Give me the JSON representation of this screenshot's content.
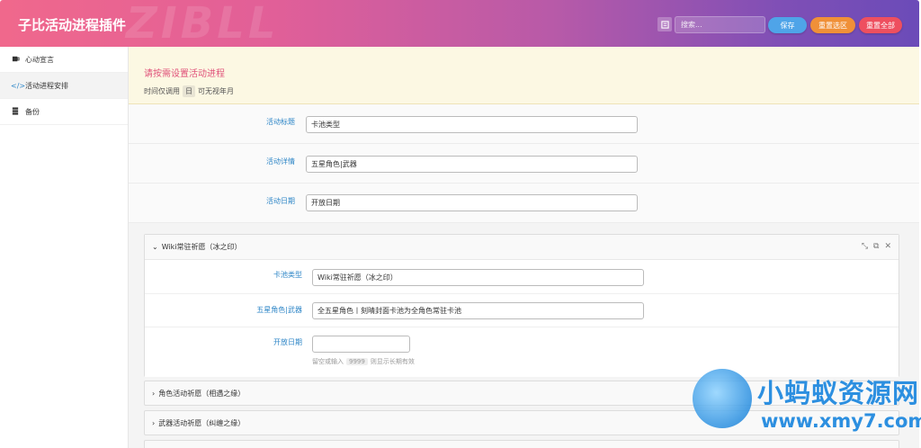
{
  "header": {
    "title": "子比活动进程插件",
    "watermark": "ZIBLL",
    "search_placeholder": "搜索...",
    "save_label": "保存",
    "reset_section_label": "重置选区",
    "reset_all_label": "重置全部"
  },
  "sidebar": {
    "items": [
      {
        "label": "心动宣言",
        "icon": "mug-icon"
      },
      {
        "label": "活动进程安排",
        "icon": "code-icon"
      },
      {
        "label": "备份",
        "icon": "database-icon"
      }
    ]
  },
  "notice": {
    "title": "请按需设置活动进程",
    "sub_before": "时间仅调用",
    "sub_code": "日",
    "sub_after": "可无视年月"
  },
  "fields": [
    {
      "label": "活动标题",
      "value": "卡池类型"
    },
    {
      "label": "活动详情",
      "value": "五星角色|武器"
    },
    {
      "label": "活动日期",
      "value": "开放日期"
    }
  ],
  "accordion": {
    "open": {
      "title": "Wiki常驻祈愿（冰之印）",
      "rows": [
        {
          "label": "卡池类型",
          "value": "Wiki常驻祈愿（冰之印）"
        },
        {
          "label": "五星角色|武器",
          "value": "全五星角色丨刻晴封面卡池为全角色常驻卡池"
        },
        {
          "label": "开放日期",
          "value": ""
        }
      ],
      "hint_before": "留空或输入",
      "hint_code": "9999",
      "hint_after": "则显示长期有效"
    },
    "collapsed": [
      {
        "title": "角色活动祈愿（相遇之缘）"
      },
      {
        "title": "武器活动祈愿（纠缠之缘）"
      }
    ]
  },
  "site_watermark": {
    "brand": "小蚂蚁资源网",
    "url": "www.xmy7.com"
  },
  "colors": {
    "label_blue": "#2e86c7",
    "notice_title": "#e0527a",
    "save": "#4fa4e8",
    "reset_section": "#f09038",
    "reset_all": "#ee4f5f"
  }
}
